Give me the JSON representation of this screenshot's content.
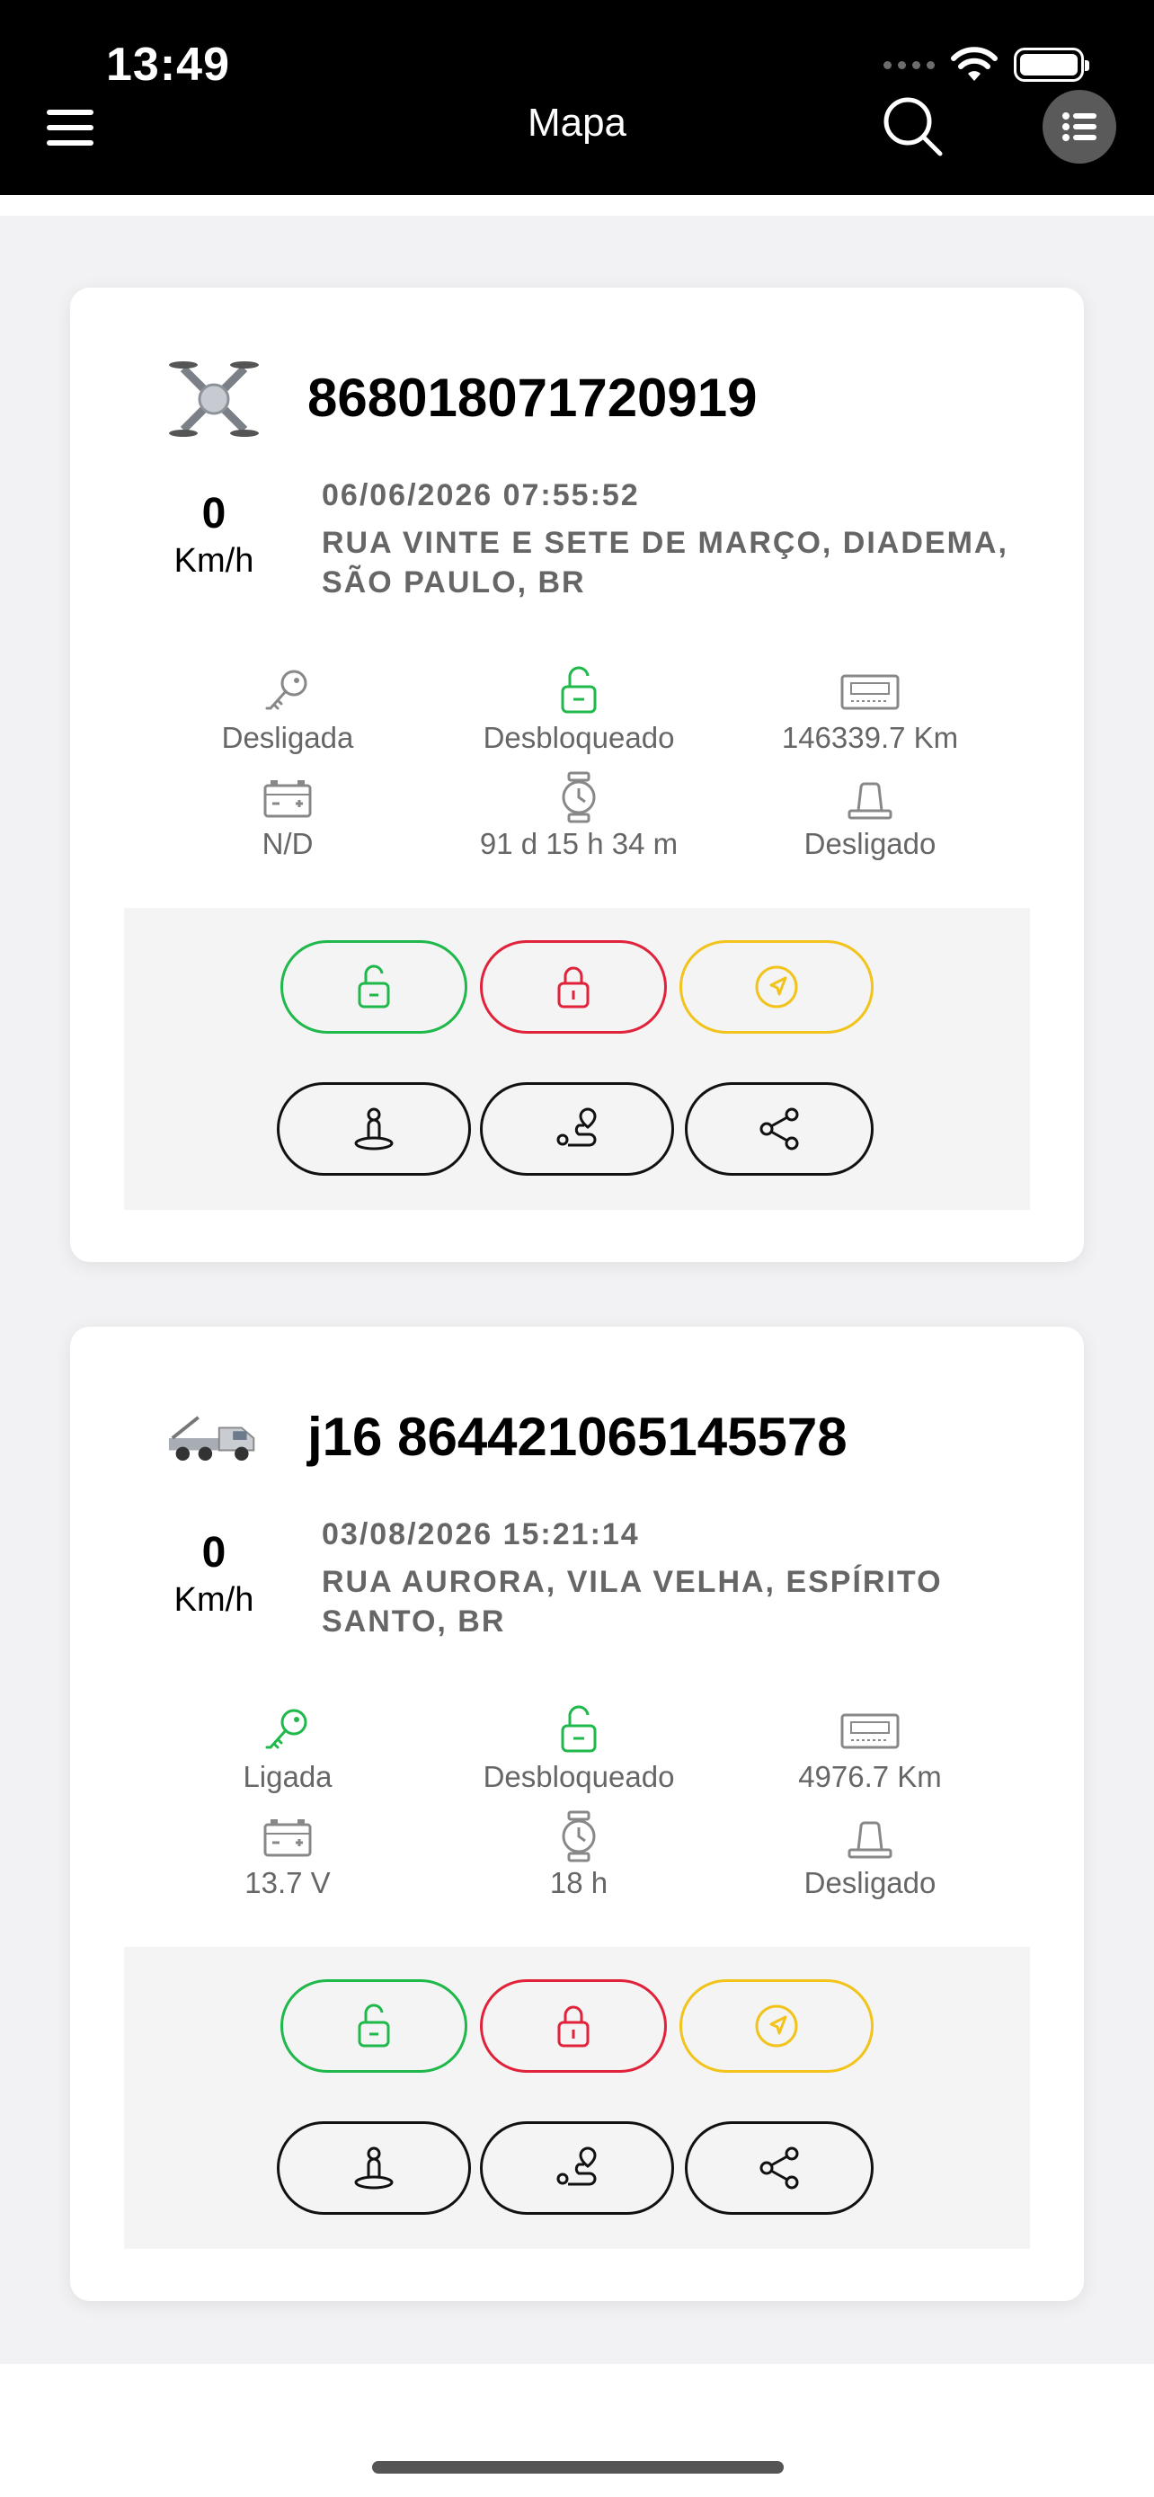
{
  "status_bar": {
    "time": "13:49"
  },
  "header": {
    "title": "Mapa"
  },
  "vehicles": [
    {
      "name": "868018071720919",
      "icon": "drone-icon",
      "speed": "0",
      "speed_unit": "Km/h",
      "datetime": "06/06/2026 07:55:52",
      "address": "RUA VINTE E SETE DE MARÇO, DIADEMA, SÃO PAULO, BR",
      "ignition": "Desligada",
      "lock": "Desbloqueado",
      "odometer": "146339.7 Km",
      "battery": "N/D",
      "duration": "91 d 15 h 34 m",
      "siren": "Desligado"
    },
    {
      "name": "j16 864421065145578",
      "icon": "tow-truck-icon",
      "speed": "0",
      "speed_unit": "Km/h",
      "datetime": "03/08/2026 15:21:14",
      "address": "RUA AURORA, VILA VELHA, ESPÍRITO SANTO, BR",
      "ignition": "Ligada",
      "lock": "Desbloqueado",
      "odometer": "4976.7 Km",
      "battery": "13.7 V",
      "duration": "18 h",
      "siren": "Desligado"
    }
  ],
  "colors": {
    "green": "#1fb84a",
    "red": "#e0223a",
    "yellow": "#f2c31a",
    "gray_text": "#666666",
    "header_bg": "#000000"
  }
}
